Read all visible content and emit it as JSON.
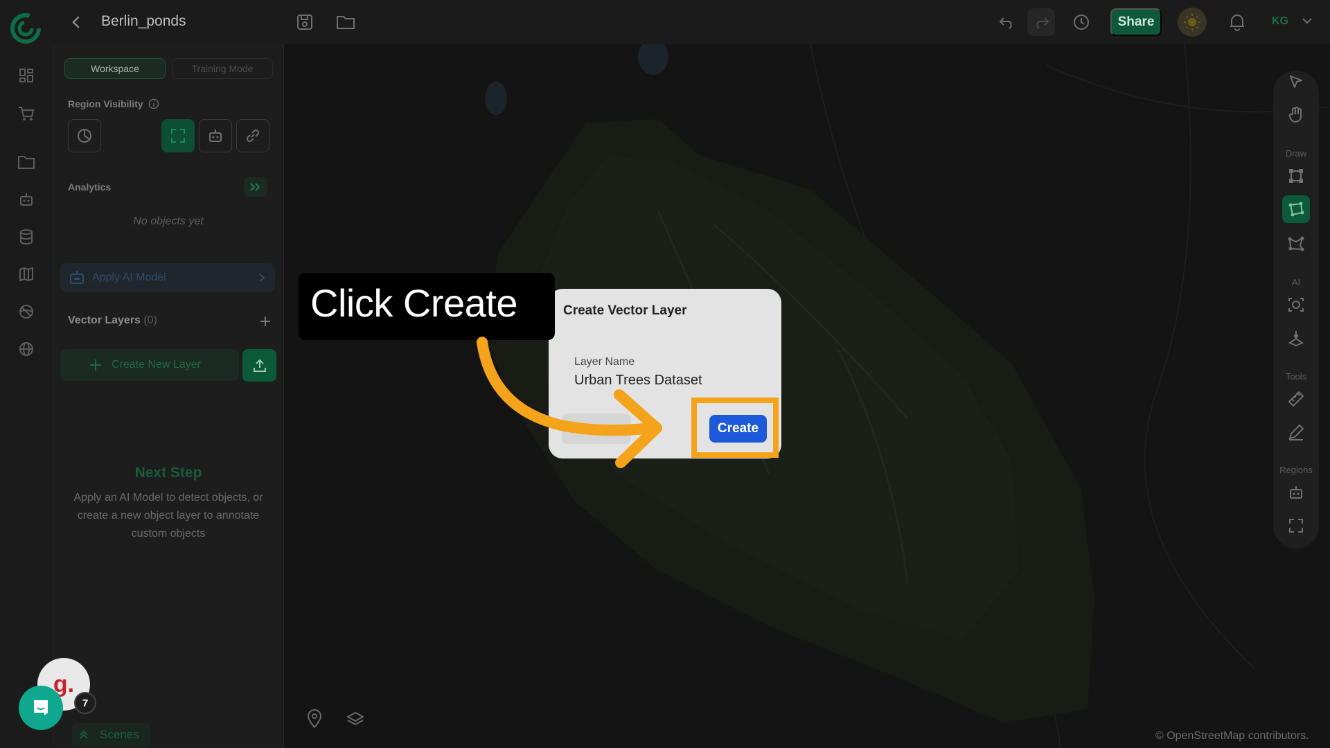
{
  "app": {
    "project_title": "Berlin_ponds"
  },
  "header": {
    "share_label": "Share",
    "user_initials": "KG"
  },
  "sidebar": {
    "tabs": [
      {
        "label": "Workspace"
      },
      {
        "label": "Training Mode"
      }
    ],
    "region_visibility_label": "Region Visibility",
    "analytics_label": "Analytics",
    "no_objects_text": "No objects yet",
    "apply_ai_label": "Apply AI Model",
    "vector_layers_label": "Vector Layers",
    "vector_layers_count": "(0)",
    "create_layer_label": "Create New Layer",
    "next_step_title": "Next Step",
    "next_step_text": "Apply an AI Model to detect objects, or create a new object layer to annotate custom objects"
  },
  "right_toolbar": {
    "draw_label": "Draw",
    "ai_label": "AI",
    "tools_label": "Tools",
    "regions_label": "Regions"
  },
  "modal": {
    "title": "Create Vector Layer",
    "field_label": "Layer Name",
    "field_value": "Urban Trees Dataset",
    "create_label": "Create"
  },
  "callout": {
    "text": "Click Create"
  },
  "map": {
    "attribution": "© OpenStreetMap contributors."
  },
  "bottom": {
    "scenes_label": "Scenes",
    "notification_count": "7",
    "brand_letter": "g."
  },
  "colors": {
    "accent_green": "#0c5a3b",
    "create_blue": "#1c5ad9",
    "highlight_orange": "#f4a31a"
  }
}
